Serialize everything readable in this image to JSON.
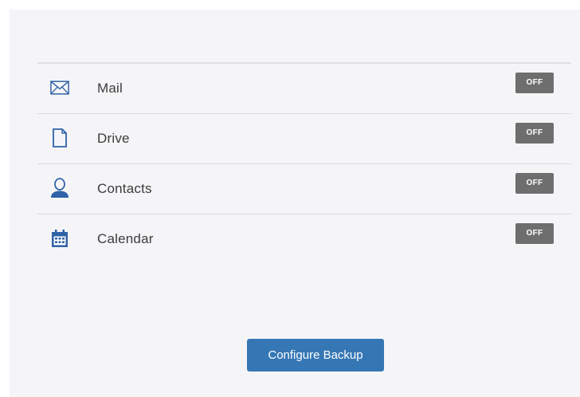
{
  "services": [
    {
      "label": "Mail",
      "icon": "mail-icon",
      "status": "OFF"
    },
    {
      "label": "Drive",
      "icon": "document-icon",
      "status": "OFF"
    },
    {
      "label": "Contacts",
      "icon": "contact-icon",
      "status": "OFF"
    },
    {
      "label": "Calendar",
      "icon": "calendar-icon",
      "status": "OFF"
    }
  ],
  "footer": {
    "configure_label": "Configure Backup"
  },
  "colors": {
    "icon": "#2f62a6",
    "toggle_off": "#6e6e6e",
    "button": "#3577b5",
    "panel_bg": "#f5f5f8"
  }
}
